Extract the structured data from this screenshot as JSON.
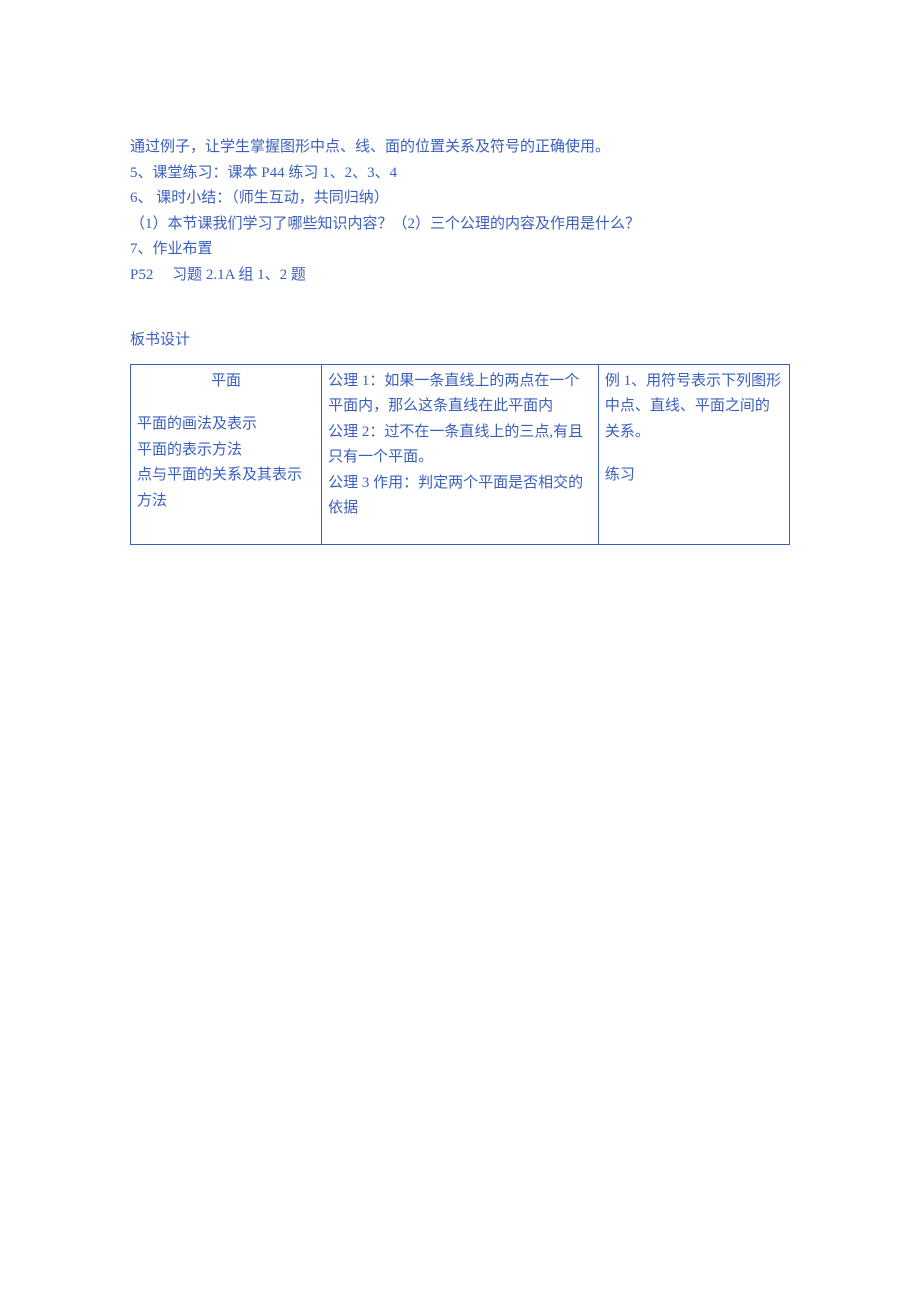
{
  "body": {
    "line1": "通过例子，让学生掌握图形中点、线、面的位置关系及符号的正确使用。",
    "line2": "5、课堂练习：课本 P44 练习 1、2、3、4",
    "line3": "6、 课时小结：（师生互动，共同归纳）",
    "line4": "（1）本节课我们学习了哪些知识内容？（2）三个公理的内容及作用是什么？",
    "line5": "7、作业布置",
    "line6": "P52  习题 2.1A 组 1、2 题"
  },
  "section": {
    "title": "板书设计"
  },
  "table": {
    "col1": {
      "title": "平面",
      "l1": "平面的画法及表示",
      "l2": "平面的表示方法",
      "l3": "点与平面的关系及其表示方法"
    },
    "col2": {
      "l1": "公理 1：如果一条直线上的两点在一个平面内，那么这条直线在此平面内",
      "l2": "公理 2：过不在一条直线上的三点,有且只有一个平面。",
      "l3": "公理 3 作用：判定两个平面是否相交的依据"
    },
    "col3": {
      "l1": "例 1、用符号表示下列图形中点、直线、平面之间的关系。",
      "l2": "练习"
    }
  }
}
